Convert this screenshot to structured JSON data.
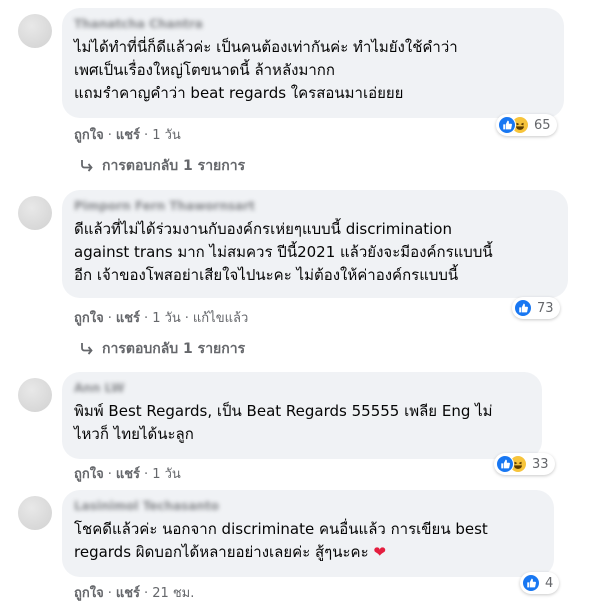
{
  "comments": [
    {
      "author": "Thanatcha Chantra",
      "text": "ไม่ได้ทำที่นี่ก็ดีแล้วค่ะ เป็นคนต้องเท่ากันค่ะ ทำไมยังใช้คำว่า\nเพศเป็นเรื่องใหญ่โตขนาดนี้ ล้าหลังมากก\nแถมรำคาญคำว่า beat regards ใครสอนมาเอ่ยยย",
      "reaction_count": "65",
      "reactions": [
        "like-icon",
        "haha-icon"
      ],
      "like": "ถูกใจ",
      "reply": "แชร์",
      "time": "1 วัน",
      "edited": "",
      "replies_label": "การตอบกลับ 1 รายการ"
    },
    {
      "author": "Pimporn Fern Thawornsart",
      "text": "ดีแล้วที่ไม่ได้ร่วมงานกับองค์กรเห่ยๆแบบนี้ discrimination\nagainst trans มาก ไม่สมควร ปีนี้2021 แล้วยังจะมีองค์กรแบบนี้\nอีก เจ้าของโพสอย่าเสียใจไปนะคะ ไม่ต้องให้ค่าองค์กรแบบนี้",
      "reaction_count": "73",
      "reactions": [
        "like-icon"
      ],
      "like": "ถูกใจ",
      "reply": "แชร์",
      "time": "1 วัน",
      "edited": "แก้ไขแล้ว",
      "replies_label": "การตอบกลับ 1 รายการ"
    },
    {
      "author": "Ann LW",
      "text": "พิมพ์ Best Regards, เป็น Beat Regards 55555 เพลีย Eng ไม่\nไหวก็ ไทยได้นะลูก",
      "reaction_count": "33",
      "reactions": [
        "like-icon",
        "haha-icon"
      ],
      "like": "ถูกใจ",
      "reply": "แชร์",
      "time": "1 วัน",
      "edited": "",
      "replies_label": ""
    },
    {
      "author": "Lasinimol Techasanto",
      "text": "โชคดีแล้วค่ะ นอกจาก discriminate คนอื่นแล้ว การเขียน best\nregards ผิดบอกได้หลายอย่างเลยค่ะ สู้ๆนะคะ",
      "heart": "❤",
      "reaction_count": "4",
      "reactions": [
        "like-icon"
      ],
      "like": "ถูกใจ",
      "reply": "แชร์",
      "time": "21 ชม.",
      "edited": "",
      "replies_label": ""
    }
  ],
  "separator": "·",
  "colors": {
    "bubble": "#f0f2f5",
    "meta": "#65676b",
    "like": "#1877f2",
    "haha": "#f7c43b",
    "heart": "#e41e3f"
  }
}
